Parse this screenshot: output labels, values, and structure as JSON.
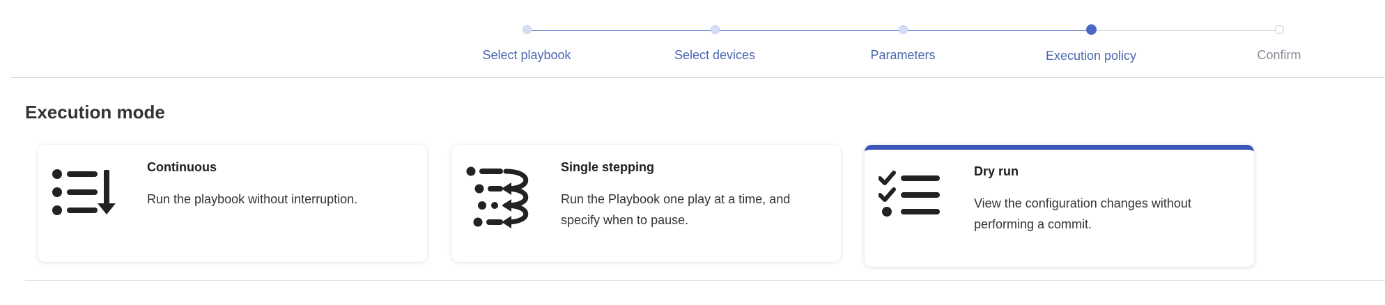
{
  "stepper": {
    "steps": [
      {
        "label": "Select playbook",
        "state": "done"
      },
      {
        "label": "Select devices",
        "state": "done"
      },
      {
        "label": "Parameters",
        "state": "done"
      },
      {
        "label": "Execution policy",
        "state": "current"
      },
      {
        "label": "Confirm",
        "state": "todo"
      }
    ],
    "colors": {
      "active": "#4a67c7",
      "inactive": "#c9ced8"
    }
  },
  "section": {
    "title": "Execution mode"
  },
  "modes": [
    {
      "title": "Continuous",
      "description": "Run the playbook without interruption.",
      "icon": "continuous-list-icon",
      "selected": false
    },
    {
      "title": "Single stepping",
      "description": "Run the Playbook one play at a time, and specify when to pause.",
      "icon": "single-stepping-icon",
      "selected": false
    },
    {
      "title": "Dry run",
      "description": "View the configuration changes without performing a commit.",
      "icon": "checklist-icon",
      "selected": true
    }
  ],
  "accent_color": "#3d57b8"
}
